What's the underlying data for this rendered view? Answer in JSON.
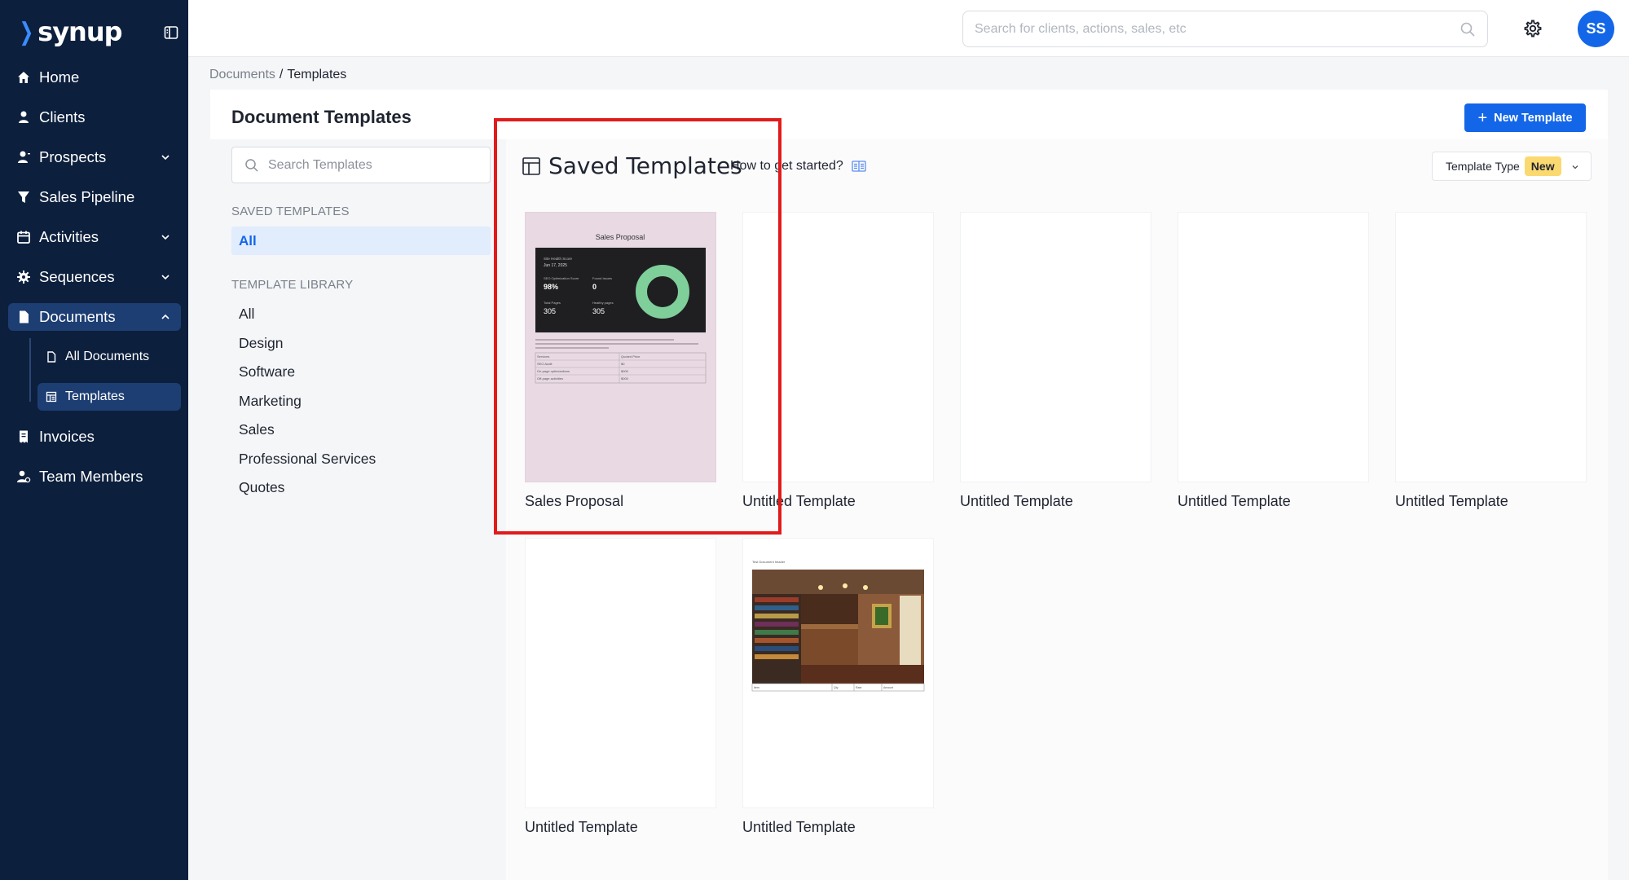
{
  "app": {
    "brand": "synup",
    "accent": "#1366e8",
    "sidebar_bg": "#0c1f3d",
    "highlight_color": "#e11b1b"
  },
  "sidebar": {
    "items": [
      {
        "label": "Home",
        "icon": "home-icon"
      },
      {
        "label": "Clients",
        "icon": "user-icon"
      },
      {
        "label": "Prospects",
        "icon": "user-plus-icon",
        "expandable": true
      },
      {
        "label": "Sales Pipeline",
        "icon": "funnel-icon"
      },
      {
        "label": "Activities",
        "icon": "calendar-icon",
        "expandable": true
      },
      {
        "label": "Sequences",
        "icon": "cog-icon",
        "expandable": true
      },
      {
        "label": "Documents",
        "icon": "document-icon",
        "expanded": true,
        "active": true
      },
      {
        "label": "Invoices",
        "icon": "receipt-icon"
      },
      {
        "label": "Team Members",
        "icon": "team-icon"
      }
    ],
    "documents_sub": [
      {
        "label": "All Documents",
        "icon": "file-icon"
      },
      {
        "label": "Templates",
        "icon": "template-icon",
        "active": true
      }
    ]
  },
  "topbar": {
    "search_placeholder": "Search for clients, actions, sales, etc",
    "avatar_initials": "SS"
  },
  "breadcrumb": {
    "parent": "Documents",
    "separator": "/",
    "current": "Templates"
  },
  "page": {
    "title": "Document Templates",
    "new_button": "New Template",
    "new_button_plus": "+"
  },
  "left_panel": {
    "search_placeholder": "Search Templates",
    "saved_label": "SAVED TEMPLATES",
    "saved_all": "All",
    "library_label": "TEMPLATE LIBRARY",
    "library_items": [
      "All",
      "Design",
      "Software",
      "Marketing",
      "Sales",
      "Professional Services",
      "Quotes"
    ]
  },
  "right_panel": {
    "title": "Saved Templates",
    "how_to": "How to get started?",
    "type_dropdown": "Template Type",
    "type_badge": "New"
  },
  "templates": [
    {
      "name": "Sales Proposal",
      "thumb": "sales-proposal"
    },
    {
      "name": "Untitled Template",
      "thumb": "blank"
    },
    {
      "name": "Untitled Template",
      "thumb": "blank"
    },
    {
      "name": "Untitled Template",
      "thumb": "blank"
    },
    {
      "name": "Untitled Template",
      "thumb": "blank"
    },
    {
      "name": "Untitled Template",
      "thumb": "blank"
    },
    {
      "name": "Untitled Template",
      "thumb": "photo-invoice"
    }
  ],
  "sales_proposal_thumb": {
    "title": "Sales Proposal",
    "health_label": "Site Health Score",
    "health_date": "Jun 17, 2025",
    "seo_label": "SEO Optimization Score",
    "seo_value": "98%",
    "issues_label": "Found Issues",
    "issues_value": "0",
    "pages_label": "Total Pages",
    "pages_value": "305",
    "healthy_label": "Healthy pages",
    "healthy_value": "305",
    "table_headers": [
      "Services",
      "Quoted Price"
    ],
    "rows": [
      [
        "SEO Audit",
        "$0"
      ],
      [
        "On-page optimizations",
        "$000"
      ],
      [
        "Off-page activities",
        "$000"
      ]
    ]
  },
  "photo_thumb": {
    "caption": "Test Document header",
    "table_headers": [
      "Item",
      "Qty",
      "Rate",
      "Amount"
    ]
  }
}
